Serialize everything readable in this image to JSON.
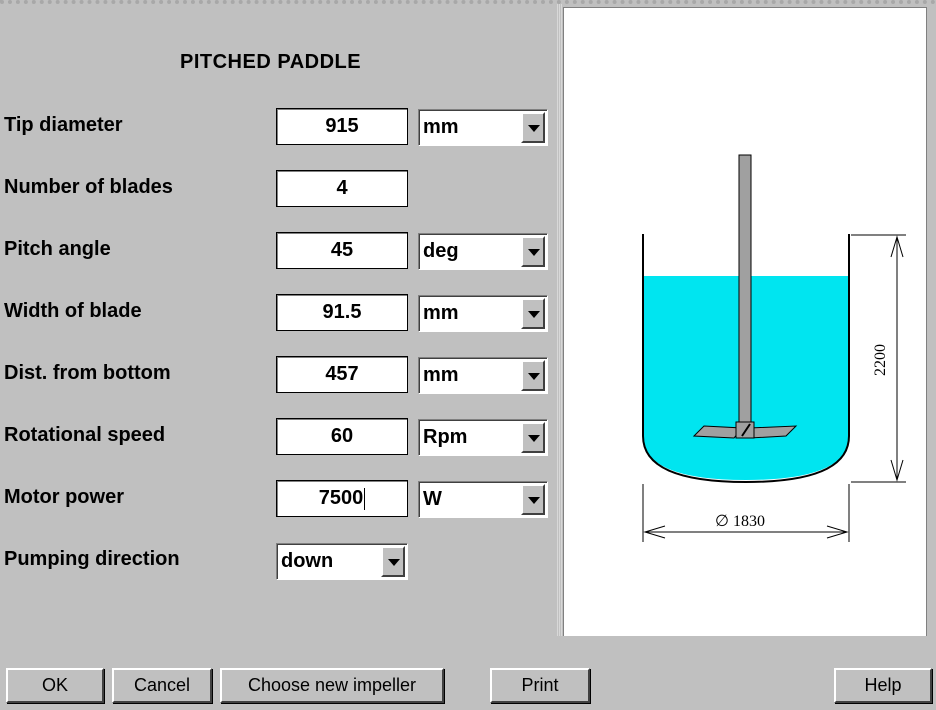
{
  "title": "PITCHED PADDLE",
  "fields": [
    {
      "label": "Tip diameter",
      "value": "915",
      "unit": "mm"
    },
    {
      "label": "Number of blades",
      "value": "4",
      "unit": ""
    },
    {
      "label": "Pitch angle",
      "value": "45",
      "unit": "deg"
    },
    {
      "label": "Width of blade",
      "value": "91.5",
      "unit": "mm"
    },
    {
      "label": "Dist. from bottom",
      "value": "457",
      "unit": "mm"
    },
    {
      "label": "Rotational speed",
      "value": "60",
      "unit": "Rpm"
    },
    {
      "label": "Motor power",
      "value": "7500",
      "unit": "W"
    },
    {
      "label": "Pumping direction",
      "value": "down",
      "unit": ""
    }
  ],
  "diagram": {
    "height_label": "2200",
    "diameter_label": "∅ 1830",
    "liquid_color": "#00e5f0"
  },
  "buttons": {
    "ok": "OK",
    "cancel": "Cancel",
    "choose": "Choose new impeller",
    "print": "Print",
    "help": "Help"
  }
}
